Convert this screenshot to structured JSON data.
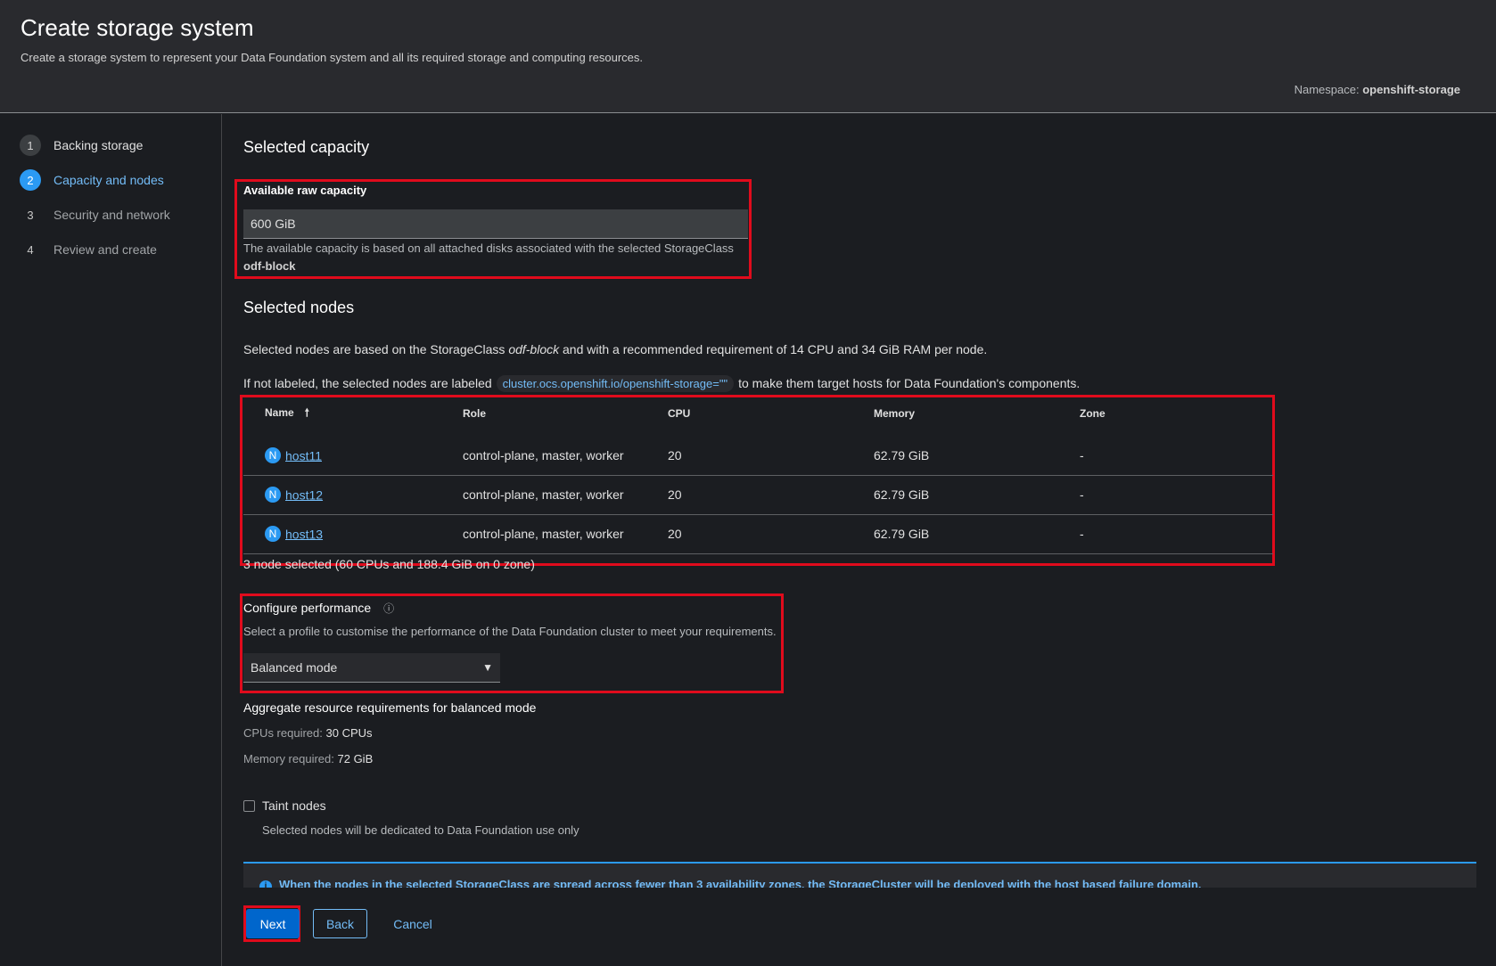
{
  "header": {
    "title": "Create storage system",
    "description": "Create a storage system to represent your Data Foundation system and all its required storage and computing resources.",
    "namespace_label": "Namespace:",
    "namespace_value": "openshift-storage"
  },
  "wizard_steps": [
    {
      "number": "1",
      "label": "Backing storage"
    },
    {
      "number": "2",
      "label": "Capacity and nodes"
    },
    {
      "number": "3",
      "label": "Security and network"
    },
    {
      "number": "4",
      "label": "Review and create"
    }
  ],
  "capacity": {
    "section_title": "Selected capacity",
    "field_label": "Available raw capacity",
    "value": "600 GiB",
    "helper_text": "The available capacity is based on all attached disks associated with the selected StorageClass",
    "storage_class": "odf-block"
  },
  "nodes": {
    "section_title": "Selected nodes",
    "desc_prefix": "Selected nodes are based on the StorageClass ",
    "desc_class": "odf-block",
    "desc_suffix": " and with a recommended requirement of 14 CPU and 34 GiB RAM per node.",
    "label_prefix": "If not labeled, the selected nodes are labeled",
    "label_chip": "cluster.ocs.openshift.io/openshift-storage=\"\"",
    "label_suffix": "to make them target hosts for Data Foundation's components.",
    "columns": [
      "Name",
      "Role",
      "CPU",
      "Memory",
      "Zone"
    ],
    "rows": [
      {
        "badge": "N",
        "name": "host11",
        "role": "control-plane, master, worker",
        "cpu": "20",
        "memory": "62.79 GiB",
        "zone": "-"
      },
      {
        "badge": "N",
        "name": "host12",
        "role": "control-plane, master, worker",
        "cpu": "20",
        "memory": "62.79 GiB",
        "zone": "-"
      },
      {
        "badge": "N",
        "name": "host13",
        "role": "control-plane, master, worker",
        "cpu": "20",
        "memory": "62.79 GiB",
        "zone": "-"
      }
    ],
    "summary": "3 node selected (60 CPUs and 188.4 GiB on 0 zone)"
  },
  "performance": {
    "label": "Configure performance",
    "helper_text": "Select a profile to customise the performance of the Data Foundation cluster to meet your requirements.",
    "selected": "Balanced mode"
  },
  "requirements": {
    "title": "Aggregate resource requirements for balanced mode",
    "cpu_label": "CPUs required:",
    "cpu_value": "30 CPUs",
    "memory_label": "Memory required:",
    "memory_value": "72 GiB"
  },
  "taint": {
    "label": "Taint nodes",
    "helper_text": "Selected nodes will be dedicated to Data Foundation use only"
  },
  "alert": {
    "text": "When the nodes in the selected StorageClass are spread across fewer than 3 availability zones, the StorageCluster will be deployed with the host based failure domain."
  },
  "footer": {
    "next_label": "Next",
    "back_label": "Back",
    "cancel_label": "Cancel"
  },
  "colors": {
    "accent": "#73bcf7",
    "primary": "#0066cc",
    "highlight": "#e00b1c"
  }
}
